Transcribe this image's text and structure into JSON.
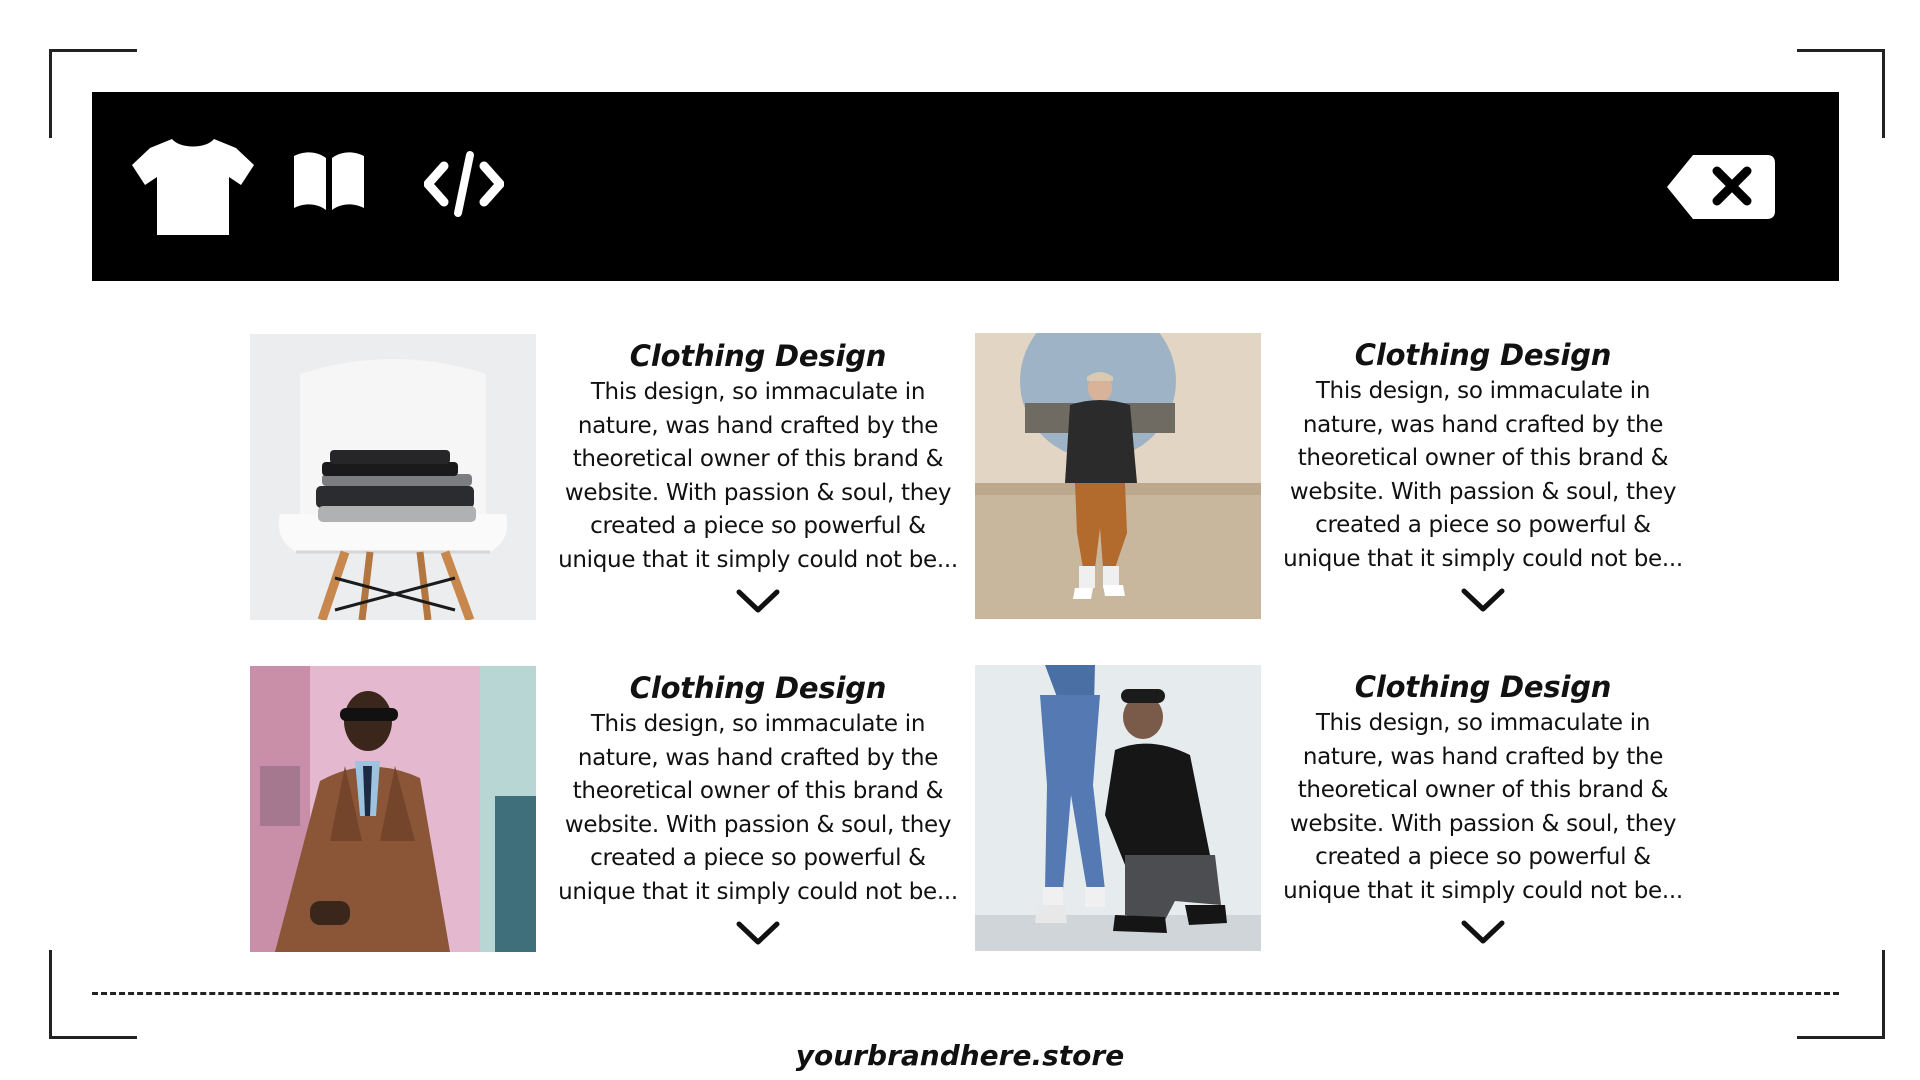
{
  "toolbar": {
    "icons": [
      "t-shirt-icon",
      "book-icon",
      "code-icon"
    ],
    "close_icon": "backspace-x-icon"
  },
  "cards": [
    {
      "image": "stacked-clothes-on-white-chair",
      "title": "Clothing Design",
      "lines": [
        "This design, so immaculate in",
        "nature, was hand crafted by the",
        "theoretical owner of this brand &",
        "website. With passion & soul, they",
        "created a piece so powerful &",
        "unique that it simply could not be..."
      ],
      "expand_icon": "chevron-down-icon"
    },
    {
      "image": "man-sitting-on-ledge",
      "title": "Clothing Design",
      "lines": [
        "This design, so immaculate in",
        "nature, was hand crafted by the",
        "theoretical owner of this brand &",
        "website. With passion & soul, they",
        "created a piece so powerful &",
        "unique that it simply could not be..."
      ],
      "expand_icon": "chevron-down-icon"
    },
    {
      "image": "man-in-brown-leather-jacket",
      "title": "Clothing Design",
      "lines": [
        "This design, so immaculate in",
        "nature, was hand crafted by the",
        "theoretical owner of this brand &",
        "website. With passion & soul, they",
        "created a piece so powerful &",
        "unique that it simply could not be..."
      ],
      "expand_icon": "chevron-down-icon"
    },
    {
      "image": "two-people-against-wall",
      "title": "Clothing Design",
      "lines": [
        "This design, so immaculate in",
        "nature, was hand crafted by the",
        "theoretical owner of this brand &",
        "website. With passion & soul, they",
        "created a piece so powerful &",
        "unique that it simply could not be..."
      ],
      "expand_icon": "chevron-down-icon"
    }
  ],
  "footer": {
    "site": "yourbrandhere.store"
  },
  "colors": {
    "bar": "#000000",
    "background": "#ffffff",
    "text": "#111111"
  }
}
